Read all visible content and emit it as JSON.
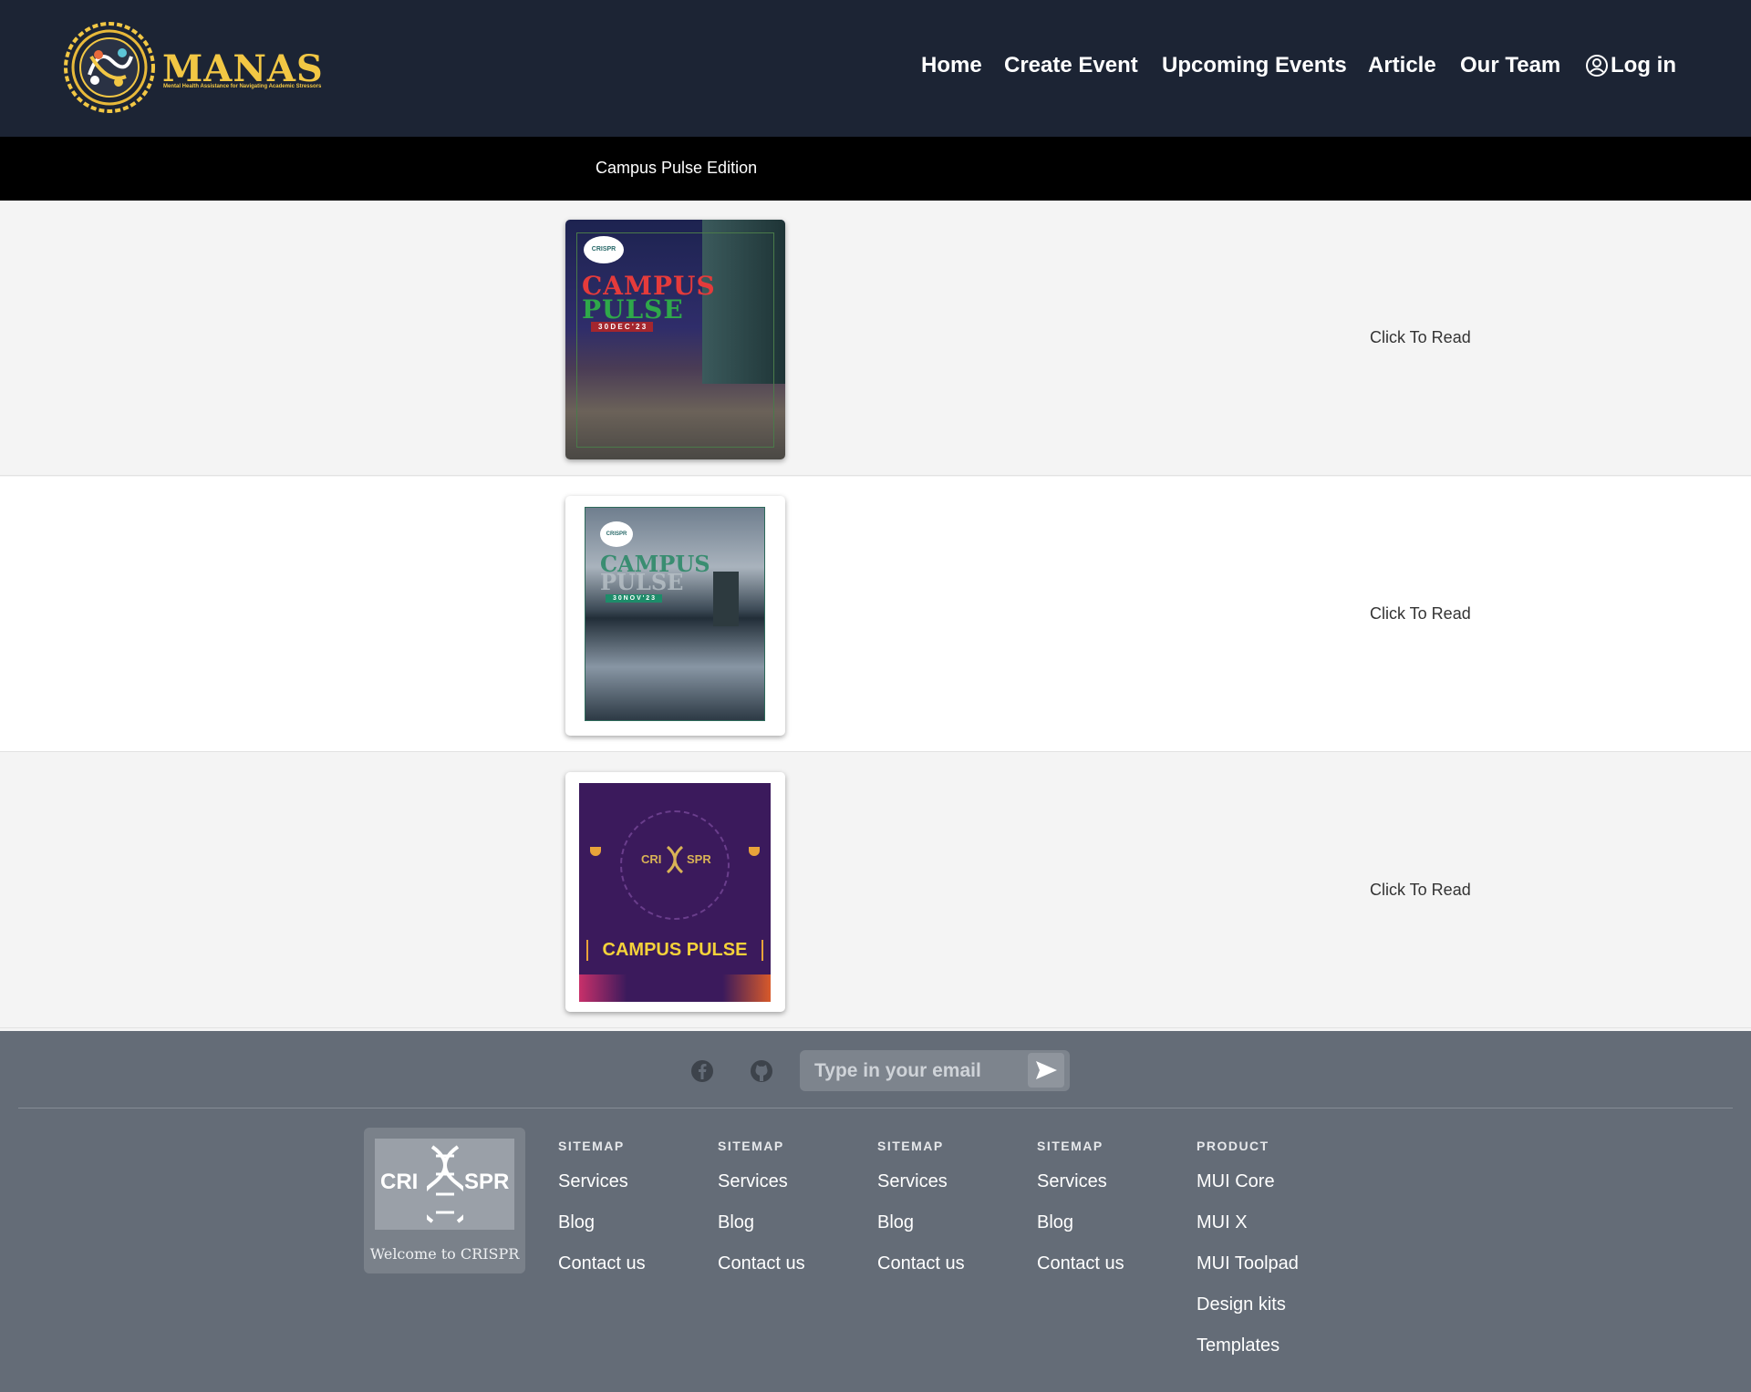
{
  "header": {
    "logo_text": "MANAS",
    "logo_tagline": "Mental Health Assistance for Navigating Academic Stressors",
    "nav": [
      "Home",
      "Create Event",
      "Upcoming Events",
      "Article",
      "Our Team"
    ],
    "login_label": "Log in"
  },
  "strip": {
    "title": "Campus Pulse Edition"
  },
  "editions": [
    {
      "cover_title_1": "CAMPUS",
      "cover_title_2": "PULSE",
      "cover_date": "3 0   D E C ' 2 3",
      "cover_badge": "CRISPR",
      "action": "Click To Read"
    },
    {
      "cover_title_1": "CAMPUS",
      "cover_title_2": "PULSE",
      "cover_date": "3 0   N O V ' 2 3",
      "cover_badge": "CRISPR",
      "action": "Click To Read"
    },
    {
      "cover_title_1": "CAMPUS PULSE",
      "cover_badge_left": "CRI",
      "cover_badge_right": "SPR",
      "action": "Click To Read"
    }
  ],
  "footer": {
    "email_placeholder": "Type in your email",
    "brand_left": "CRI",
    "brand_right": "SPR",
    "brand_welcome": "Welcome to CRISPR",
    "columns": [
      {
        "heading": "SITEMAP",
        "links": [
          "Services",
          "Blog",
          "Contact us"
        ]
      },
      {
        "heading": "SITEMAP",
        "links": [
          "Services",
          "Blog",
          "Contact us"
        ]
      },
      {
        "heading": "SITEMAP",
        "links": [
          "Services",
          "Blog",
          "Contact us"
        ]
      },
      {
        "heading": "SITEMAP",
        "links": [
          "Services",
          "Blog",
          "Contact us"
        ]
      },
      {
        "heading": "PRODUCT",
        "links": [
          "MUI Core",
          "MUI X",
          "MUI Toolpad",
          "Design kits",
          "Templates"
        ]
      }
    ]
  },
  "colors": {
    "header_bg": "#1c2434",
    "strip_bg": "#000000",
    "footer_bg": "#646c77",
    "logo_gold": "#f2c744"
  },
  "icons": [
    "mandala-logo-icon",
    "user-circle-icon",
    "facebook-icon",
    "github-icon",
    "send-arrow-icon",
    "dna-icon"
  ]
}
